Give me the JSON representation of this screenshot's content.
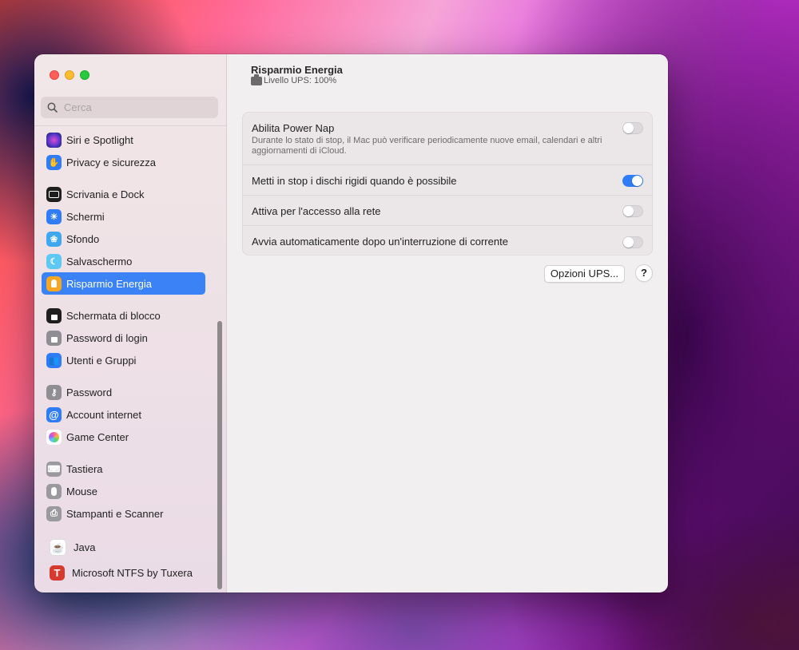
{
  "sidebar": {
    "search_placeholder": "Cerca",
    "items": [
      {
        "label": "Siri e Spotlight",
        "icon": "siri-icon"
      },
      {
        "label": "Privacy e sicurezza",
        "icon": "hand-icon"
      },
      {
        "label": "Scrivania e Dock",
        "icon": "dock-icon"
      },
      {
        "label": "Schermi",
        "icon": "sun-icon"
      },
      {
        "label": "Sfondo",
        "icon": "flower-icon"
      },
      {
        "label": "Salvaschermo",
        "icon": "moon-icon"
      },
      {
        "label": "Risparmio Energia",
        "icon": "bulb-icon",
        "selected": true
      },
      {
        "label": "Schermata di blocco",
        "icon": "lock-icon"
      },
      {
        "label": "Password di login",
        "icon": "padlock-icon"
      },
      {
        "label": "Utenti e Gruppi",
        "icon": "users-icon"
      },
      {
        "label": "Password",
        "icon": "key-icon"
      },
      {
        "label": "Account internet",
        "icon": "at-icon"
      },
      {
        "label": "Game Center",
        "icon": "game-center-icon"
      },
      {
        "label": "Tastiera",
        "icon": "keyboard-icon"
      },
      {
        "label": "Mouse",
        "icon": "mouse-icon"
      },
      {
        "label": "Stampanti e Scanner",
        "icon": "printer-icon"
      },
      {
        "label": "Java",
        "icon": "java-icon"
      },
      {
        "label": "Microsoft NTFS by Tuxera",
        "icon": "tuxera-icon"
      }
    ]
  },
  "header": {
    "title": "Risparmio Energia",
    "subtitle": "Livello UPS: 100%"
  },
  "settings": [
    {
      "label": "Abilita Power Nap",
      "description": "Durante lo stato di stop, il Mac può verificare periodicamente nuove email, calendari e altri aggiornamenti di iCloud.",
      "enabled": false
    },
    {
      "label": "Metti in stop i dischi rigidi quando è possibile",
      "enabled": true
    },
    {
      "label": "Attiva per l'accesso alla rete",
      "enabled": false
    },
    {
      "label": "Avvia automaticamente dopo un'interruzione di corrente",
      "enabled": false
    }
  ],
  "buttons": {
    "ups_options": "Opzioni UPS...",
    "help": "?"
  },
  "colors": {
    "accent": "#3b82f6",
    "toggle_on": "#2f7cf6"
  }
}
